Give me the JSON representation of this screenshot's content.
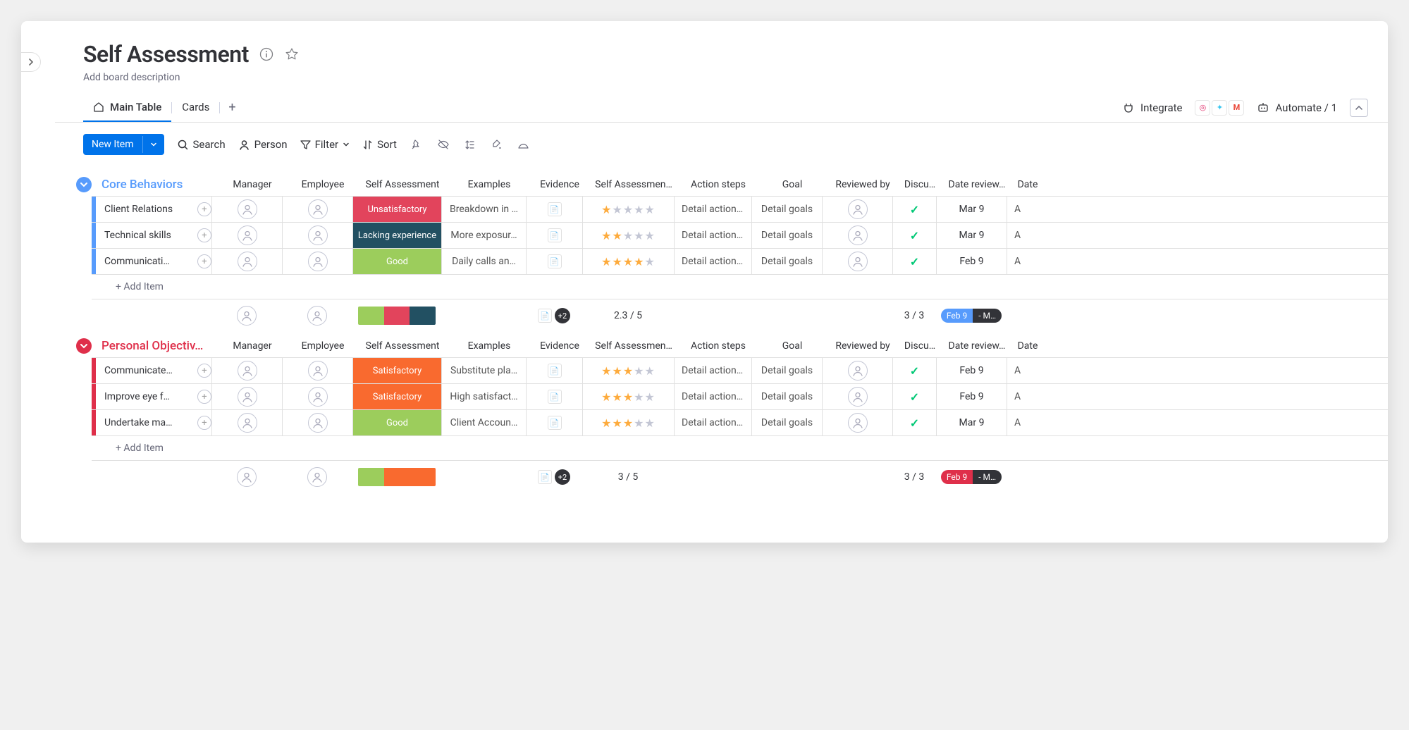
{
  "header": {
    "title": "Self Assessment",
    "desc": "Add board description"
  },
  "tabs": {
    "main": "Main Table",
    "cards": "Cards",
    "integrate": "Integrate",
    "automate": "Automate / 1"
  },
  "toolbar": {
    "new_item": "New Item",
    "search": "Search",
    "person": "Person",
    "filter": "Filter",
    "sort": "Sort"
  },
  "columns": {
    "manager": "Manager",
    "employee": "Employee",
    "self": "Self Assessment",
    "examples": "Examples",
    "evidence": "Evidence",
    "self_rate": "Self Assessmen…",
    "action": "Action steps",
    "goal": "Goal",
    "reviewed": "Reviewed by",
    "discussed": "Discu…",
    "date_rev": "Date review…",
    "date": "Date"
  },
  "status_labels": {
    "unsat": "Unsatisfactory",
    "lack": "Lacking experience",
    "good": "Good",
    "sat": "Satisfactory"
  },
  "status_colors": {
    "unsat": "#e2445c",
    "lack": "#225062",
    "good": "#9ccd5c",
    "sat": "#f96a2f"
  },
  "common": {
    "add_item": "+ Add Item",
    "detail_action": "Detail action st…",
    "detail_goals": "Detail goals",
    "evidence_plus": "+2"
  },
  "groups": [
    {
      "name": "Core Behaviors",
      "color": "#579bfc",
      "rows": [
        {
          "name": "Client Relations",
          "status": "unsat",
          "example": "Breakdown in …",
          "stars": 1,
          "date": "Mar 9"
        },
        {
          "name": "Technical skills",
          "status": "lack",
          "example": "More exposur…",
          "stars": 2,
          "date": "Mar 9"
        },
        {
          "name": "Communicati…",
          "status": "good",
          "example": "Daily calls an…",
          "stars": 4,
          "date": "Feb 9"
        }
      ],
      "summary": {
        "rate": "2.3  / 5",
        "disc": "3 / 3",
        "date_pill": {
          "a": "Feb 9",
          "b": "- M…",
          "ac": "#579bfc",
          "bc": "#323338"
        },
        "bar": [
          {
            "c": "#9ccd5c",
            "p": 33.3
          },
          {
            "c": "#e2445c",
            "p": 33.3
          },
          {
            "c": "#225062",
            "p": 33.4
          }
        ]
      }
    },
    {
      "name": "Personal Objectiv…",
      "color": "#df2f4a",
      "rows": [
        {
          "name": "Communicate…",
          "status": "sat",
          "example": "Substitute pla…",
          "stars": 3,
          "date": "Feb 9"
        },
        {
          "name": "Improve eye f…",
          "status": "sat",
          "example": "High satisfact…",
          "stars": 3,
          "date": "Feb 9"
        },
        {
          "name": "Undertake ma…",
          "status": "good",
          "example": "Client Accoun…",
          "stars": 3,
          "date": "Mar 9"
        }
      ],
      "summary": {
        "rate": "3  / 5",
        "disc": "3 / 3",
        "date_pill": {
          "a": "Feb 9",
          "b": "- M…",
          "ac": "#df2f4a",
          "bc": "#323338"
        },
        "bar": [
          {
            "c": "#9ccd5c",
            "p": 33.3
          },
          {
            "c": "#f96a2f",
            "p": 66.7
          }
        ]
      }
    }
  ]
}
